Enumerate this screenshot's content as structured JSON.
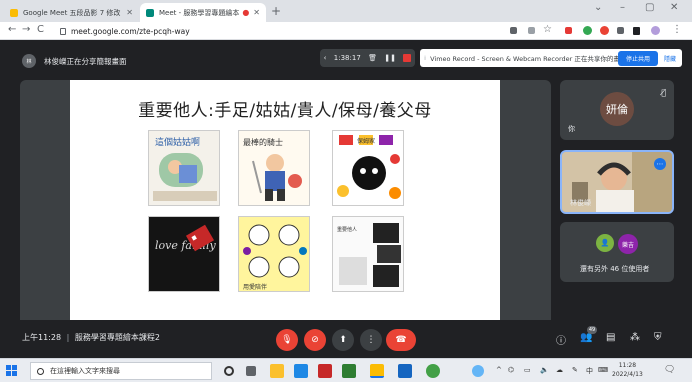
{
  "browser": {
    "tabs": [
      {
        "title": "Google Meet 五段品影 7 修改 n",
        "active": false
      },
      {
        "title": "Meet - 服務學習專題繪本 ...",
        "active": true
      }
    ],
    "address": "meet.google.com/zte-pcqh-way"
  },
  "meet": {
    "presenter_banner": "林俊嶸正在分享簡報畫面",
    "recorder": {
      "elapsed": "1:38:17",
      "message": "Vimeo Record - Screen & Webcam Recorder 正在共享你的畫面。",
      "stop_label": "停止共用",
      "hide_label": "隱藏"
    },
    "slide": {
      "title": "重要他人:手足/姑姑/貴人/保母/養父母",
      "cards": [
        {
          "text": "這個姑姑啊"
        },
        {
          "text": "最棒的騎士"
        },
        {
          "text": "保姆家"
        },
        {
          "text": "love family"
        },
        {
          "text": "用愛陪伴"
        },
        {
          "text": "重要他人"
        }
      ]
    },
    "participants": [
      {
        "name": "妍倫",
        "label": "你",
        "avatar_text": "妍倫"
      },
      {
        "name": "林俊嶸",
        "video": true
      },
      {
        "name": "樂吉",
        "others_label": "還有另外 46 位使用者"
      }
    ],
    "footer": {
      "time": "上午11:28",
      "meeting_name": "服務學習專題繪本課程2",
      "participant_count": "49"
    }
  },
  "taskbar": {
    "search_placeholder": "在這裡輸入文字來搜尋",
    "time": "11:28",
    "date": "2022/4/13",
    "ime": "中"
  },
  "colors": {
    "meet_bg": "#202124",
    "hangup": "#ea4335",
    "accent": "#1a73e8"
  }
}
